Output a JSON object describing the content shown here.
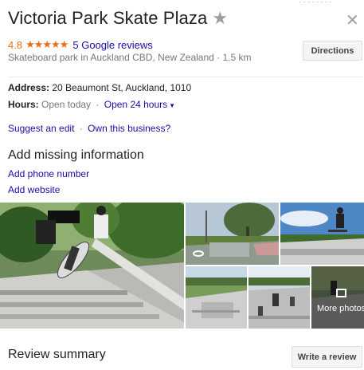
{
  "place": {
    "title": "Victoria Park Skate Plaza",
    "rating": "4.8",
    "stars": "★★★★★",
    "reviews_link": "5 Google reviews",
    "subtitle": "Skateboard park in Auckland CBD, New Zealand · 1.5 km"
  },
  "buttons": {
    "directions": "Directions",
    "write_review": "Write a review"
  },
  "address": {
    "label": "Address:",
    "value": "20 Beaumont St, Auckland, 1010"
  },
  "hours": {
    "label": "Hours:",
    "status": "Open today",
    "separator": "·",
    "value": "Open 24 hours"
  },
  "edit_links": {
    "suggest": "Suggest an edit",
    "separator": "·",
    "own": "Own this business?"
  },
  "missing_info": {
    "heading": "Add missing information",
    "phone": "Add phone number",
    "website": "Add website"
  },
  "photos": {
    "more_label": "More photos"
  },
  "review_summary": {
    "heading": "Review summary"
  },
  "icons": {
    "star": "star-icon",
    "close": "close-icon",
    "dropdown": "caret-down-icon",
    "view360": "rotate-360-icon",
    "gallery": "photo-gallery-icon"
  },
  "colors": {
    "rating": "#e7711b",
    "link": "#1a0dab",
    "muted": "#777777"
  }
}
